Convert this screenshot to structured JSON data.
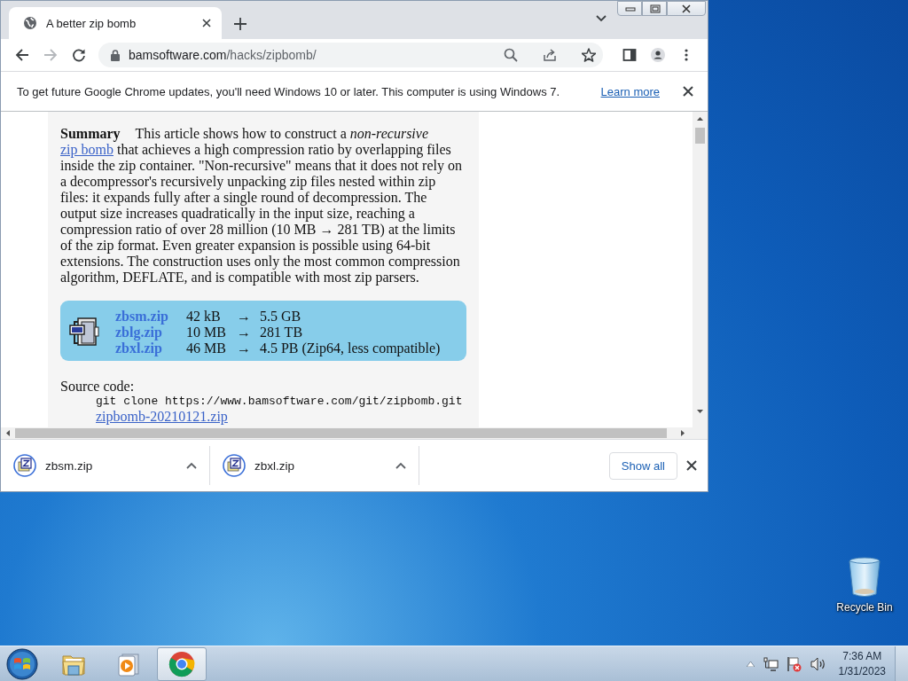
{
  "browser": {
    "tabs": [
      {
        "title": "A better zip bomb",
        "selected": true
      }
    ],
    "address": {
      "domain": "bamsoftware.com",
      "path": "/hacks/zipbomb/"
    },
    "infobar": {
      "message": "To get future Google Chrome updates, you'll need Windows 10 or later. This computer is using Windows 7.",
      "link": "Learn more"
    },
    "article": {
      "heading": "Summary",
      "text_before": "This article shows how to construct a *non-recursive*",
      "link": "zip bomb",
      "text_after": "that achieves a high compression ratio by overlapping files inside the zip container. \"Non-recursive\" means that it does not rely on a decompressor's recursively unpacking zip files nested within zip files: it expands fully after a single round of decompression. The output size increases quadratically in the input size, reaching a compression ratio of over 28 million (10 MB → 281 TB) at the limits of the zip format. Even greater expansion is possible using 64-bit extensions. The construction uses only the most common compression algorithm, DEFLATE, and is compatible with most zip parsers.",
      "files": [
        {
          "name": "zbsm.zip",
          "size": "42 kB",
          "arrow": "→",
          "result": "5.5 GB"
        },
        {
          "name": "zblg.zip",
          "size": "10 MB",
          "arrow": "→",
          "result": "281 TB"
        },
        {
          "name": "zbxl.zip",
          "size": "46 MB",
          "arrow": "→",
          "result": "4.5 PB (Zip64, less compatible)"
        }
      ],
      "source_label": "Source code:",
      "command": "git clone https://www.bamsoftware.com/git/zipbomb.git",
      "archive_link": "zipbomb-20210121.zip"
    },
    "downloads": {
      "items": [
        {
          "name": "zbsm.zip"
        },
        {
          "name": "zbxl.zip"
        }
      ],
      "show_all": "Show all"
    }
  },
  "desktop_icons": [
    {
      "label": "Recycle Bin"
    }
  ],
  "taskbar": {
    "apps": [
      {
        "kind": "explorer",
        "selected": false
      },
      {
        "kind": "media",
        "selected": false
      },
      {
        "kind": "chrome",
        "selected": true
      }
    ],
    "time": "7:36 AM",
    "date": "1/31/2023"
  }
}
